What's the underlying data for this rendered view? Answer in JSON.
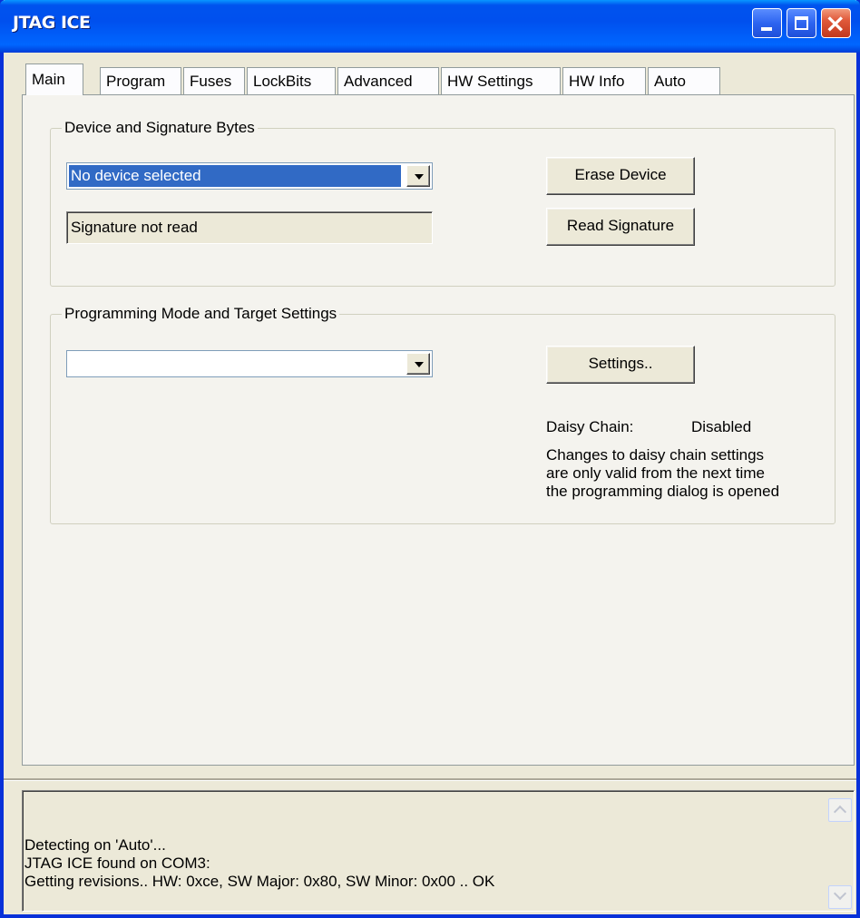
{
  "window": {
    "title": "JTAG ICE"
  },
  "tabs": [
    {
      "label": "Main",
      "active": true
    },
    {
      "label": "Program"
    },
    {
      "label": "Fuses"
    },
    {
      "label": "LockBits"
    },
    {
      "label": "Advanced"
    },
    {
      "label": "HW Settings"
    },
    {
      "label": "HW Info"
    },
    {
      "label": "Auto"
    }
  ],
  "device_group": {
    "legend": "Device and Signature Bytes",
    "device_select": "No device selected",
    "signature_text": "Signature not read",
    "erase_button": "Erase Device",
    "read_signature_button": "Read Signature"
  },
  "programming_group": {
    "legend": "Programming Mode and Target Settings",
    "mode_select": "",
    "settings_button": "Settings..",
    "daisy_chain_label": "Daisy Chain:",
    "daisy_chain_value": "Disabled",
    "note_lines": [
      "Changes to daisy chain settings",
      "are only valid from the next time",
      "the programming dialog is opened"
    ]
  },
  "log": {
    "lines": [
      "Detecting on 'Auto'...",
      "JTAG ICE found on COM3:",
      "Getting revisions.. HW: 0xce, SW Major: 0x80, SW Minor: 0x00 .. OK"
    ]
  },
  "colors": {
    "titlebar": "#0053ee",
    "selection": "#316ac5",
    "dialog_bg": "#ece9d8"
  }
}
